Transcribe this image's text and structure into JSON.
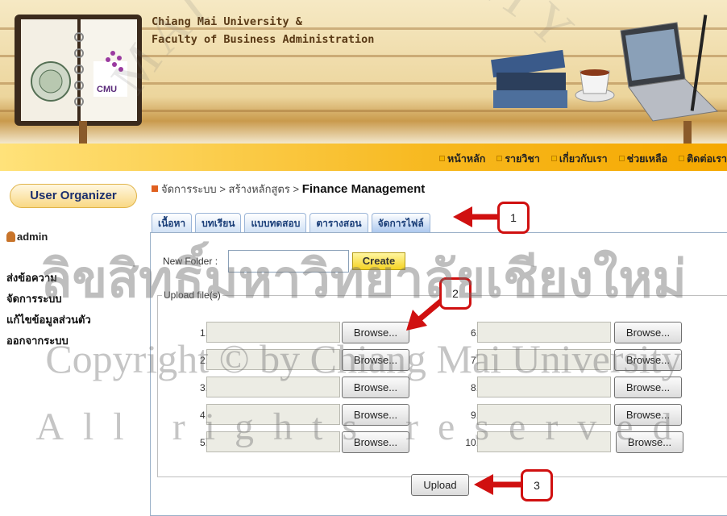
{
  "header": {
    "title_line1": "Chiang Mai University &",
    "title_line2": "Faculty of Business Administration",
    "logo_text": "CMU"
  },
  "nav": [
    "หน้าหลัก",
    "รายวิชา",
    "เกี่ยวกับเรา",
    "ช่วยเหลือ",
    "ติดต่อเรา"
  ],
  "sidebar": {
    "title": "User Organizer",
    "user": "admin",
    "links": [
      "ส่งข้อความ",
      "จัดการระบบ",
      "แก้ไขข้อมูลส่วนตัว",
      "ออกจากระบบ"
    ]
  },
  "breadcrumb": {
    "item1": "จัดการระบบ",
    "item2": "สร้างหลักสูตร",
    "current": "Finance Management",
    "separator": ">"
  },
  "tabs": [
    "เนื้อหา",
    "บทเรียน",
    "แบบทดสอบ",
    "ตารางสอน",
    "จัดการไฟล์"
  ],
  "active_tab": "จัดการไฟล์",
  "new_folder": {
    "label": "New Folder :",
    "value": "",
    "button": "Create"
  },
  "upload": {
    "legend": "Upload file(s)",
    "browse_label": "Browse...",
    "numbers": [
      "1.",
      "2.",
      "3.",
      "4.",
      "5.",
      "6.",
      "7.",
      "8.",
      "9.",
      "10."
    ],
    "button": "Upload"
  },
  "callouts": [
    "1",
    "2",
    "3"
  ],
  "watermark": {
    "line1": "ลิขสิทธิ์มหาวิทยาลัยเชียงใหม่",
    "line2": "Copyright © by Chiang Mai University",
    "line3": "All rights reserved",
    "arc": "MAI UNIVERSITY"
  },
  "colors": {
    "nav_bar": "#f7b81e",
    "tab_text": "#1a3e78",
    "create_button": "#f5d324",
    "callout_border": "#d01010"
  }
}
